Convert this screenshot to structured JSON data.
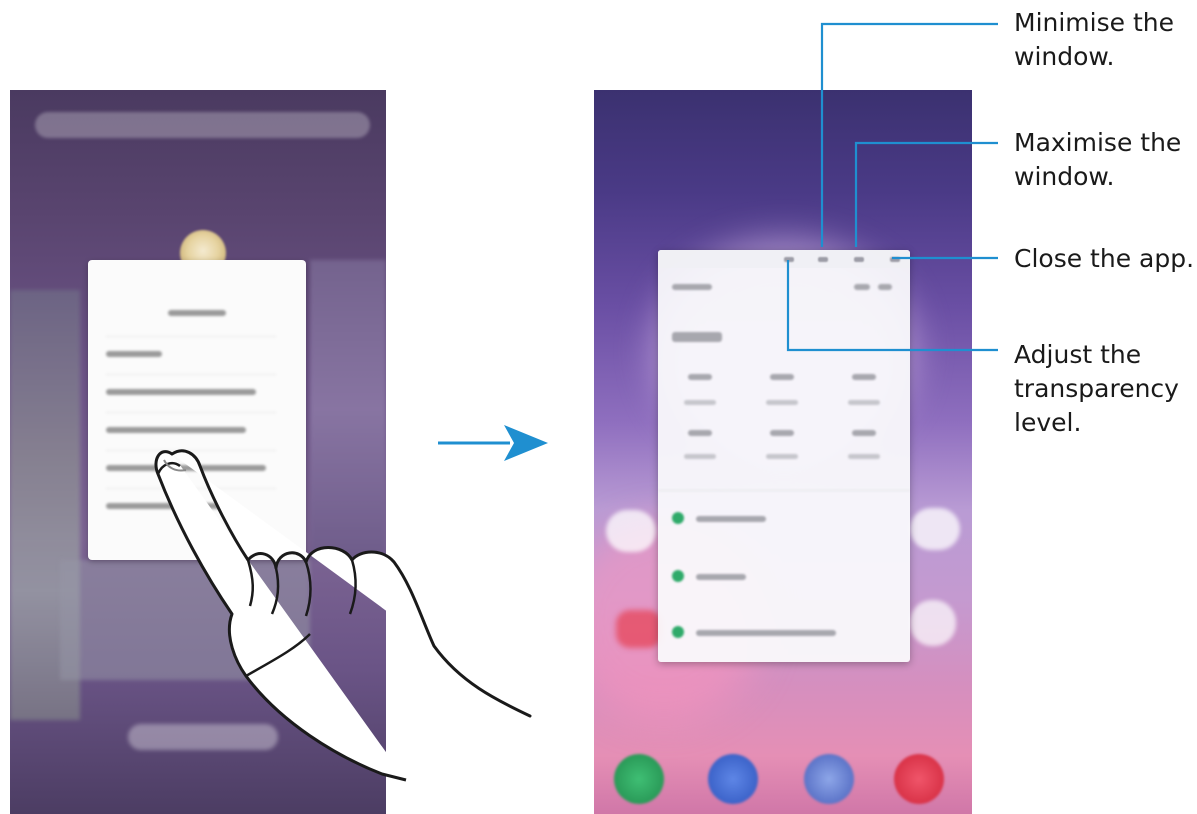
{
  "callouts": {
    "minimise": "Minimise the\nwindow.",
    "maximise": "Maximise the\nwindow.",
    "close": "Close the app.",
    "transparency": "Adjust the\ntransparency\nlevel."
  },
  "colors": {
    "callout_line": "#1f8fd0",
    "arrow": "#1f8fd0",
    "text": "#1a1a1a"
  },
  "icons": {
    "transition_arrow": "right-arrow-icon",
    "hand": "pointing-hand-icon"
  }
}
